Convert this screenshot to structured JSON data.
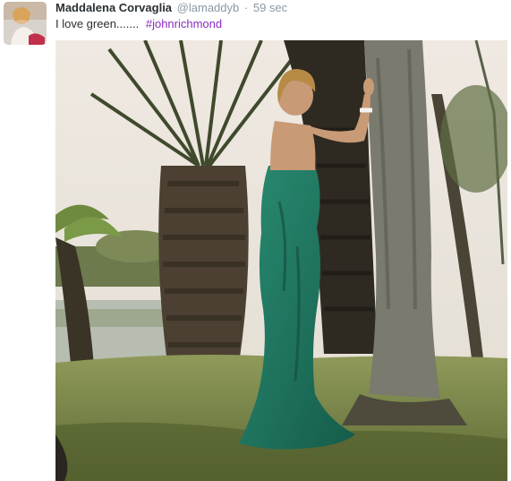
{
  "tweet": {
    "author_name": "Maddalena Corvaglia",
    "author_handle": "@lamaddyb",
    "separator": "·",
    "timestamp": "59 sec",
    "text": "I love green.......",
    "hashtag": "#johnrichmond"
  },
  "colors": {
    "name": "#292f33",
    "meta": "#8899a6",
    "hashtag": "#8a2bbf",
    "dress": "#1f7a64"
  },
  "icons": {
    "avatar": "user-avatar-photo",
    "photo": "tweet-photo"
  }
}
